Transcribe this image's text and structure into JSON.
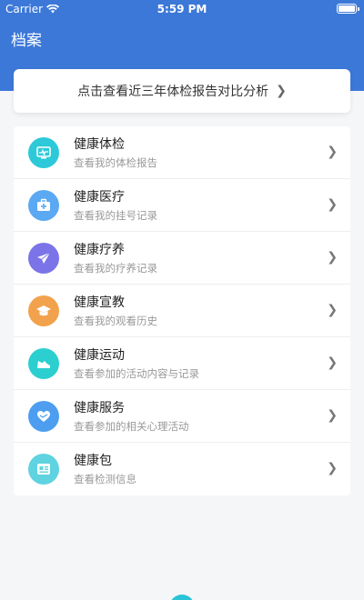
{
  "status": {
    "carrier": "Carrier",
    "time": "5:59 PM"
  },
  "nav": {
    "title": "档案"
  },
  "banner": {
    "text": "点击查看近三年体检报告对比分析"
  },
  "menu": [
    {
      "name": "health-checkup",
      "title": "健康体检",
      "subtitle": "查看我的体检报告",
      "icon": "monitor-icon",
      "color": "#2dc9d8"
    },
    {
      "name": "health-medical",
      "title": "健康医疗",
      "subtitle": "查看我的挂号记录",
      "icon": "medical-kit-icon",
      "color": "#5aa9f2"
    },
    {
      "name": "health-recuperation",
      "title": "健康疗养",
      "subtitle": "查看我的疗养记录",
      "icon": "airplane-icon",
      "color": "#7b74e8"
    },
    {
      "name": "health-education",
      "title": "健康宣教",
      "subtitle": "查看我的观看历史",
      "icon": "graduation-cap-icon",
      "color": "#f2a24c"
    },
    {
      "name": "health-exercise",
      "title": "健康运动",
      "subtitle": "查看参加的活动内容与记录",
      "icon": "sneaker-icon",
      "color": "#2ccfcf"
    },
    {
      "name": "health-service",
      "title": "健康服务",
      "subtitle": "查看参加的相关心理活动",
      "icon": "heart-hands-icon",
      "color": "#4d9ef0"
    },
    {
      "name": "health-package",
      "title": "健康包",
      "subtitle": "查看检测信息",
      "icon": "device-card-icon",
      "color": "#5fd3e0"
    }
  ]
}
